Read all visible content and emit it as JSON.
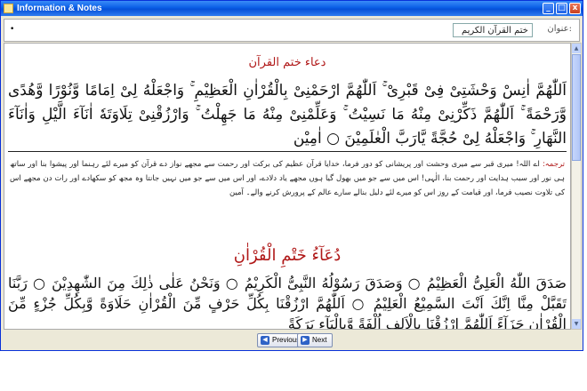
{
  "window": {
    "title": "Information & Notes"
  },
  "controls": {
    "min": "_",
    "max": "□",
    "close": "x"
  },
  "topbar": {
    "dropdown_glyph": "•",
    "name_value": "ختم القرآن الکریم",
    "name_label": "عنوان:"
  },
  "content": {
    "heading1": "دعاء ختم القرآن",
    "arabic1": "اَللّٰهُمَّ اٰنِسْ وَحْشَتِیْ فِیْ قَبْرِیْ ۚ اَللّٰهُمَّ ارْحَمْنِیْ بِالْقُرْاٰنِ الْعَظِیْمِ ۚ وَاجْعَلْهُ لِیْ اِمَامًا وَّنُوْرًا وَّهُدًی وَّرَحْمَةً ۚ اَللّٰهُمَّ ذَكِّرْنِیْ مِنْهُ مَا نَسِیْتُ ۚ وَعَلِّمْنِیْ مِنْهُ مَا جَهِلْتُ ۚ وَارْزُقْنِیْ تِلَاوَتَهٗ اٰنَآءَ الَّیْلِ وَاٰنَآءَ النَّهَارِ ۚ وَاجْعَلْهُ لِیْ حُجَّةً یَّارَبَّ الْعٰلَمِیْنَ ○ اٰمِیْن",
    "translation_label": "ترجمہ:",
    "translation_text": "اے اللہ! میری قبر سے میری وحشت اور پریشانی کو دور فرما، خدایا قرآن عظیم کی برکت اور رحمت سے مجھے نواز دے قرآن کو میرے لئے رہنما اور پیشوا بنا اور ساتھ ہی نور اور سبب ہدایت اور رحمت بنا، الٰہی! اس میں سے جو میں بھول گیا ہوں مجھے یاد دلادے، اور اس میں سے جو میں نہیں جانتا وہ مجھ کو سکھادے اور رات دن مجھے اس کی تلاوت نصیب فرما، اور قیامت کے روز اس کو میرے لئے دلیل بنالے سارے عالم کے پرورش کرنے والے۔ آمین",
    "heading2": "دُعَآءُ خَتْمِ الْقُرْاٰنِ",
    "arabic2": "صَدَقَ اللّٰهُ الْعَلِیُّ الْعَظِیْمُ ○ وَصَدَقَ رَسُوْلُهُ النَّبِیُّ الْكَرِیْمُ ○ وَنَحْنُ عَلٰی ذٰلِكَ مِنَ الشّٰهِدِیْنَ ○ رَبَّنَا تَقَبَّلْ مِنَّا اِنَّكَ اَنْتَ السَّمِیْعُ الْعَلِیْمُ ○ اَللّٰهُمَّ ارْزُقْنَا بِكُلِّ حَرْفٍ مِّنَ الْقُرْاٰنِ حَلَاوَةً وَّبِكُلِّ جُزْءٍ مِّنَ الْقُرْاٰنِ جَزَآءً اَللّٰهُمَّ ارْزُقْنَا بِالْاَلِفِ اُلْفَةً وَّبِالْبَآءِ بَرَكَةً"
  },
  "footer": {
    "previous_label": "Previous",
    "next_label": "Next"
  }
}
